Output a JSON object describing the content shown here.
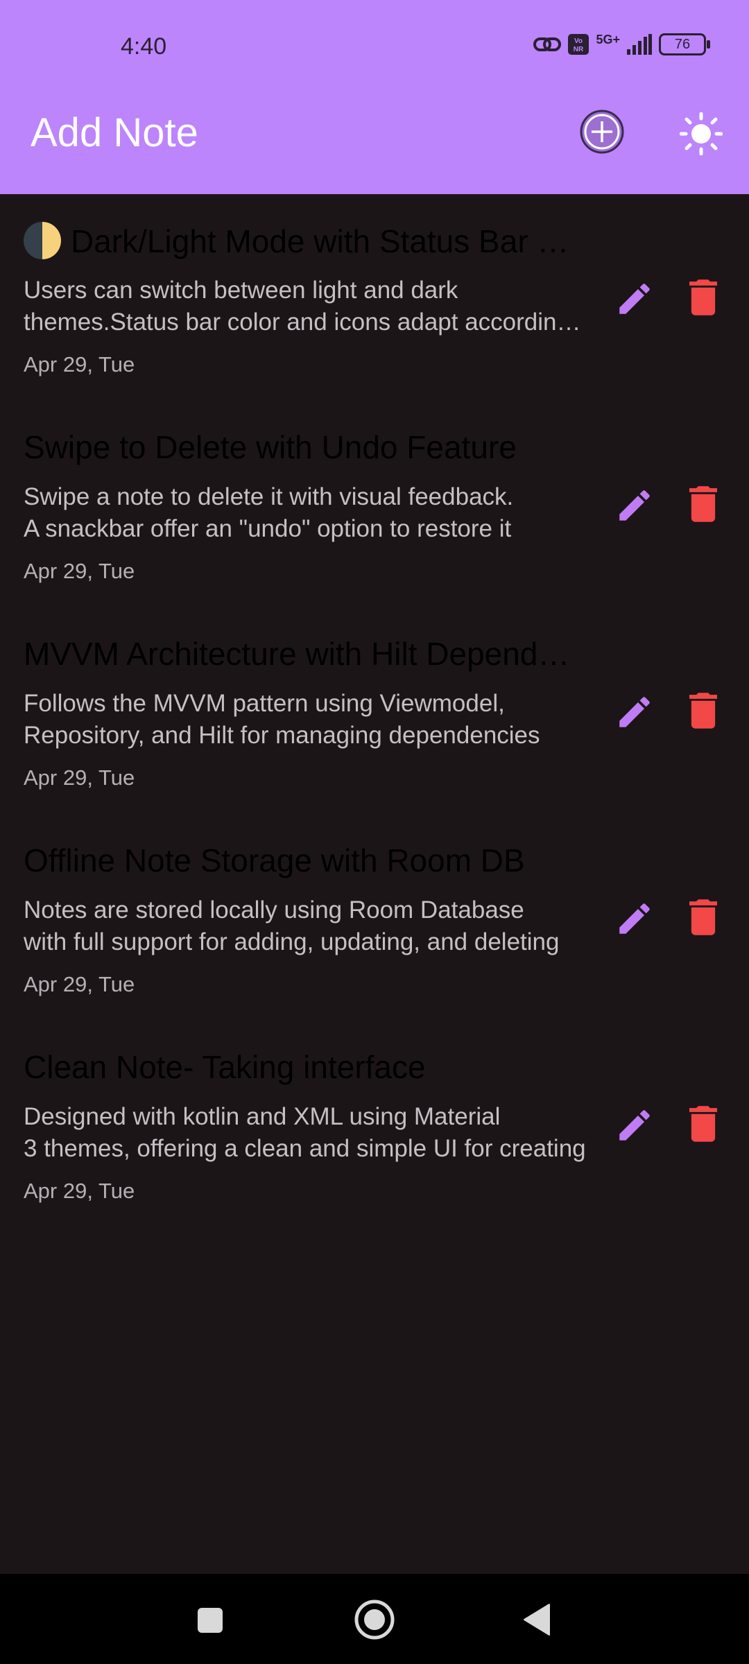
{
  "status_bar": {
    "time": "4:40",
    "volte_label": "Vo NR",
    "network_label": "5G+",
    "battery": "76"
  },
  "header": {
    "title": "Add Note",
    "add_icon": "add-circle-icon",
    "theme_icon": "sun-icon"
  },
  "notes": [
    {
      "title": "Dark/Light Mode with Status Bar Sync",
      "desc_line1": "Users can switch between light and dark",
      "desc_line2": "themes.Status bar color and icons adapt accordingly",
      "date": "Apr 29, Tue"
    },
    {
      "title": "Swipe to Delete with Undo Feature",
      "desc_line1": "Swipe a note to delete it with visual feedback.",
      "desc_line2": "A snackbar offer an \"undo\" option to restore it",
      "date": "Apr 29, Tue"
    },
    {
      "title": "MVVM Architecture with Hilt Dependency Injection",
      "desc_line1": "Follows the MVVM pattern using Viewmodel,",
      "desc_line2": "Repository, and Hilt for managing dependencies",
      "date": "Apr 29, Tue"
    },
    {
      "title": "Offline Note Storage with Room DB",
      "desc_line1": "Notes are stored locally using Room Database",
      "desc_line2": "with full support for adding, updating, and deleting",
      "date": "Apr 29, Tue"
    },
    {
      "title": "Clean Note- Taking interface",
      "desc_line1": "Designed with kotlin and XML using Material",
      "desc_line2": "3 themes, offering a clean and simple UI for creating",
      "date": "Apr 29, Tue"
    }
  ],
  "colors": {
    "accent": "#bc85fb",
    "background": "#1c1518",
    "edit_icon": "#c07cf5",
    "delete_icon": "#f24848"
  }
}
